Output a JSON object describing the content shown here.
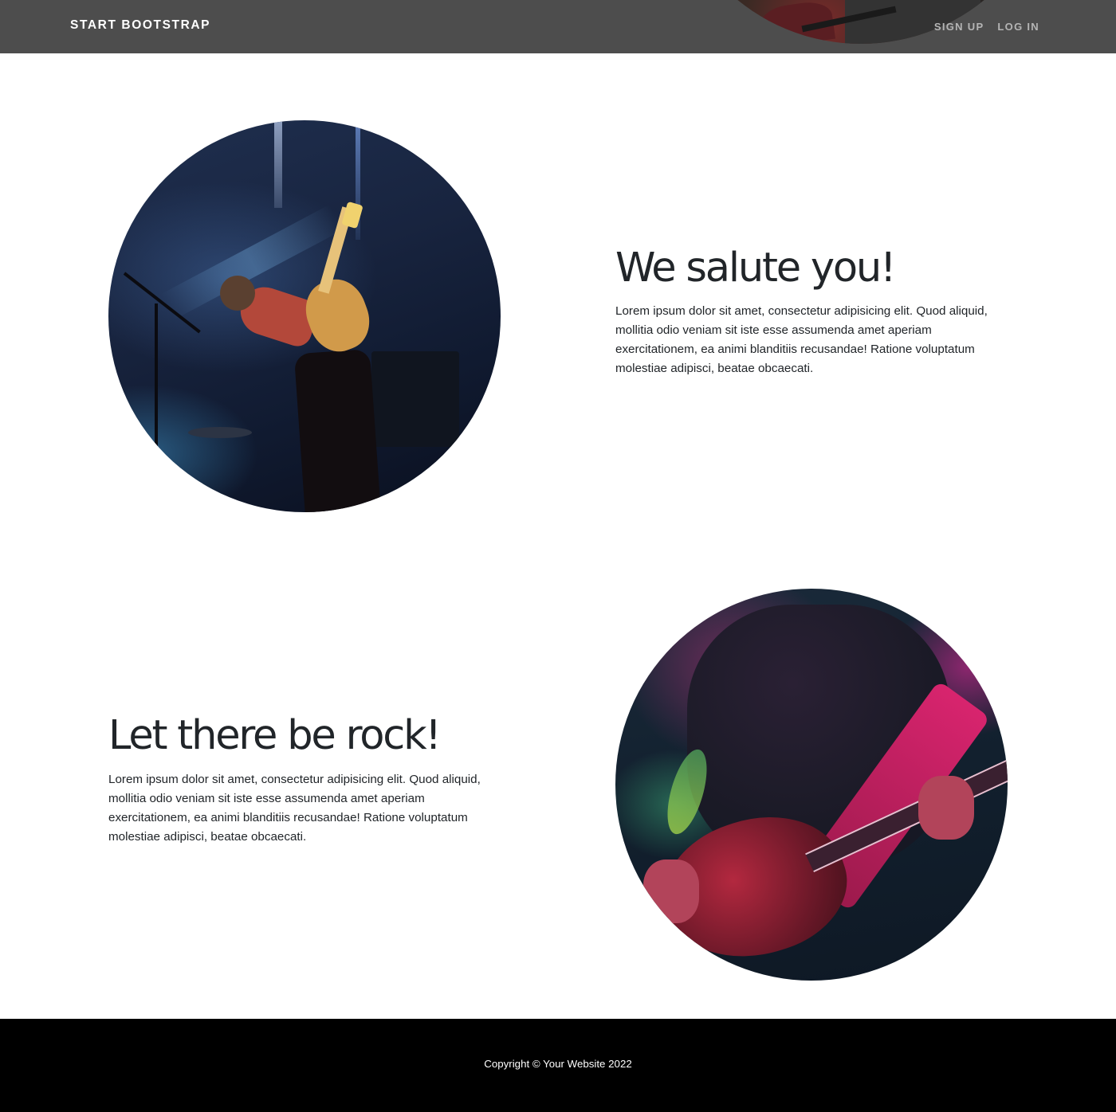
{
  "navbar": {
    "brand": "Start Bootstrap",
    "links": [
      {
        "label": "Sign Up"
      },
      {
        "label": "Log In"
      }
    ]
  },
  "sections": [
    {
      "heading": "We salute you!",
      "text": "Lorem ipsum dolor sit amet, consectetur adipisicing elit. Quod aliquid, mollitia odio veniam sit iste esse assumenda amet aperiam exercitationem, ea animi blanditiis recusandae! Ratione voluptatum molestiae adipisci, beatae obcaecati."
    },
    {
      "heading": "Let there be rock!",
      "text": "Lorem ipsum dolor sit amet, consectetur adipisicing elit. Quod aliquid, mollitia odio veniam sit iste esse assumenda amet aperiam exercitationem, ea animi blanditiis recusandae! Ratione voluptatum molestiae adipisci, beatae obcaecati."
    }
  ],
  "footer": {
    "copyright": "Copyright © Your Website 2022"
  },
  "colors": {
    "navbar_bg": "#4d4d4d",
    "footer_bg": "#000000",
    "nav_link": "#b5b5b5"
  }
}
